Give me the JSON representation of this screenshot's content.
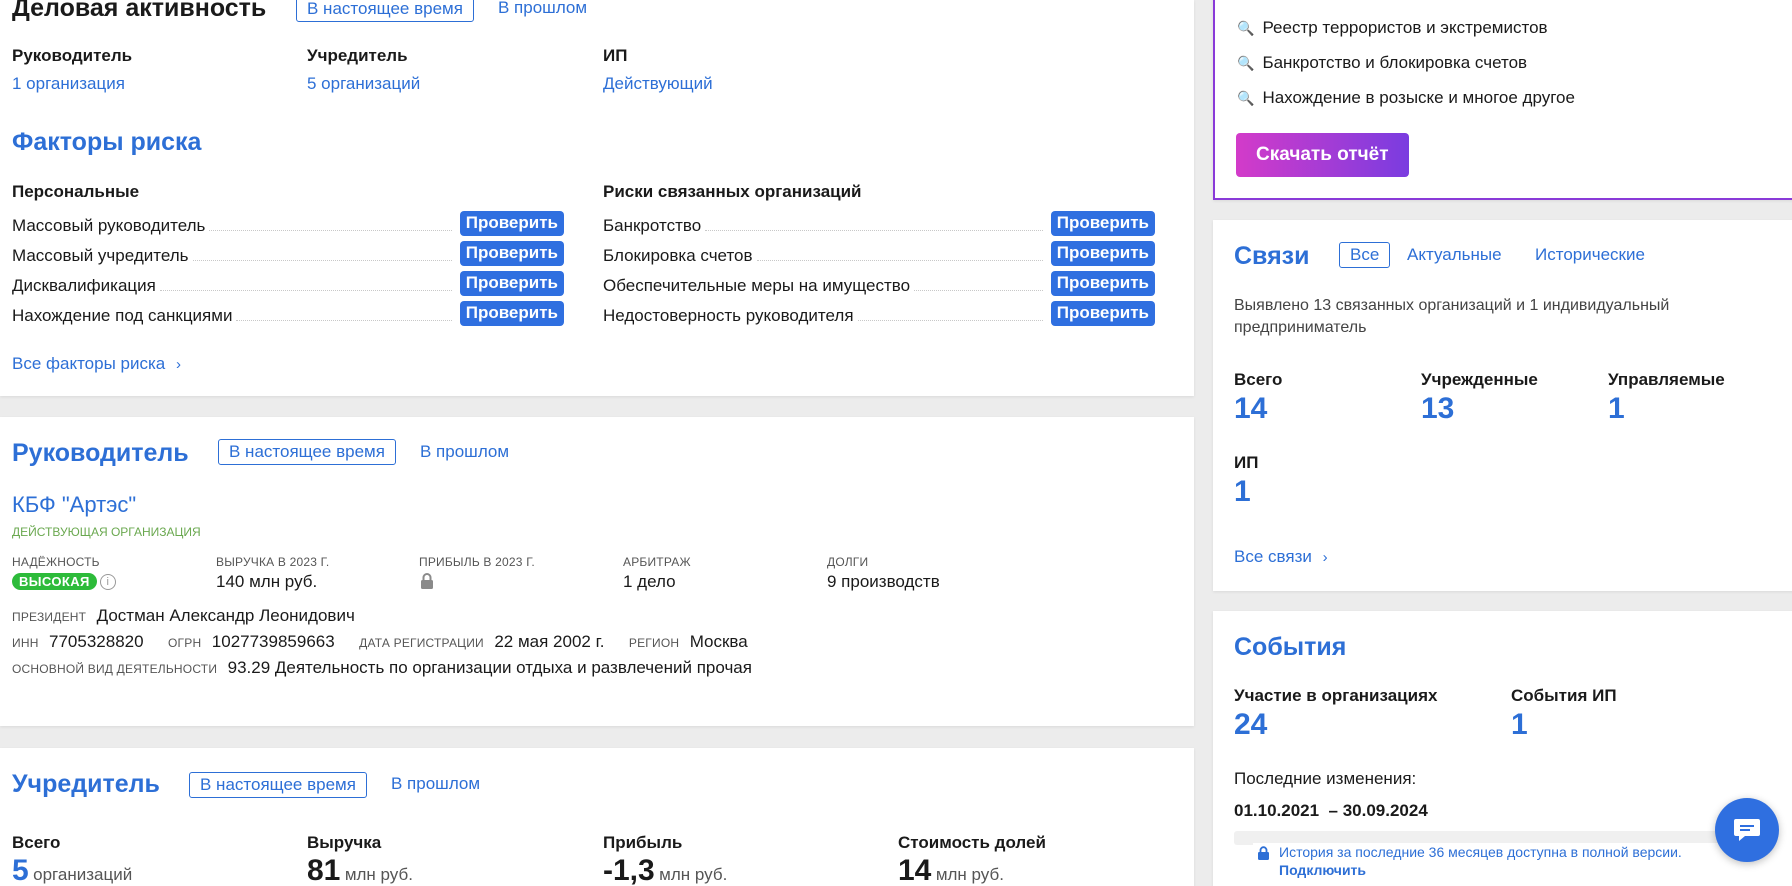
{
  "business": {
    "title": "Деловая активность",
    "tab_now": "В настоящее время",
    "tab_past": "В прошлом",
    "cols": [
      {
        "label": "Руководитель",
        "value": "1 организация"
      },
      {
        "label": "Учредитель",
        "value": "5 организаций"
      },
      {
        "label": "ИП",
        "value": "Действующий"
      }
    ]
  },
  "risk": {
    "title": "Факторы риска",
    "personal_title": "Персональные",
    "related_title": "Риски связанных организаций",
    "check_label": "Проверить",
    "personal": [
      "Массовый руководитель",
      "Массовый учредитель",
      "Дисквалификация",
      "Нахождение под санкциями"
    ],
    "related": [
      "Банкротство",
      "Блокировка счетов",
      "Обеспечительные меры на имущество",
      "Недостоверность руководителя"
    ],
    "all_link": "Все факторы риска"
  },
  "director": {
    "title": "Руководитель",
    "tab_now": "В настоящее время",
    "tab_past": "В прошлом",
    "org_name": "КБФ \"Артэс\"",
    "org_status": "ДЕЙСТВУЮЩАЯ ОРГАНИЗАЦИЯ",
    "reliability_label": "НАДЁЖНОСТЬ",
    "reliability_value": "ВЫСОКАЯ",
    "revenue_label": "ВЫРУЧКА В 2023 Г.",
    "revenue_value": "140 млн руб.",
    "profit_label": "ПРИБЫЛЬ В 2023 Г.",
    "arbitr_label": "АРБИТРАЖ",
    "arbitr_value": "1 дело",
    "debts_label": "ДОЛГИ",
    "debts_value": "9 производств",
    "president_label": "ПРЕЗИДЕНТ",
    "president_value": "Достман Александр Леонидович",
    "inn_label": "ИНН",
    "inn_value": "7705328820",
    "ogrn_label": "ОГРН",
    "ogrn_value": "1027739859663",
    "regdate_label": "ДАТА РЕГИСТРАЦИИ",
    "regdate_value": "22 мая 2002 г.",
    "region_label": "РЕГИОН",
    "region_value": "Москва",
    "activity_label": "ОСНОВНОЙ ВИД ДЕЯТЕЛЬНОСТИ",
    "activity_value": "93.29 Деятельность по организации отдыха и развлечений прочая"
  },
  "founder": {
    "title": "Учредитель",
    "tab_now": "В настоящее время",
    "tab_past": "В прошлом",
    "stats": [
      {
        "label": "Всего",
        "value": "5",
        "unit": "организаций"
      },
      {
        "label": "Выручка",
        "value": "81",
        "unit": "млн руб."
      },
      {
        "label": "Прибыль",
        "value": "-1,3",
        "unit": "млн руб."
      },
      {
        "label": "Стоимость долей",
        "value": "14",
        "unit": "млн руб."
      }
    ]
  },
  "promo": {
    "items": [
      "Реестр террористов и экстремистов",
      "Банкротство и блокировка счетов",
      "Нахождение в розыске и многое другое"
    ],
    "download_label": "Скачать отчёт"
  },
  "links": {
    "title": "Связи",
    "tab_all": "Все",
    "tab_actual": "Актуальные",
    "tab_hist": "Исторические",
    "description": "Выявлено 13 связанных организаций и 1 индивидуальный предприниматель",
    "stats": [
      {
        "label": "Всего",
        "value": "14"
      },
      {
        "label": "Учрежденные",
        "value": "13"
      },
      {
        "label": "Управляемые",
        "value": "1"
      },
      {
        "label": "ИП",
        "value": "1"
      }
    ],
    "all_link": "Все связи"
  },
  "events": {
    "title": "События",
    "stats": [
      {
        "label": "Участие в организациях",
        "value": "24"
      },
      {
        "label": "События ИП",
        "value": "1"
      }
    ],
    "last_changes_label": "Последние изменения:",
    "period": "01.10.2021  – 30.09.2024",
    "history_note": "История за последние 36 месяцев доступна в полной версии.",
    "connect_link": "Подключить"
  },
  "colors": {
    "accent": "#2d6fd6",
    "button": "#2f6fe0",
    "badge_green": "#2dbb3a",
    "promo_gradient_start": "#d33bc9",
    "promo_gradient_end": "#7a3ce0"
  }
}
